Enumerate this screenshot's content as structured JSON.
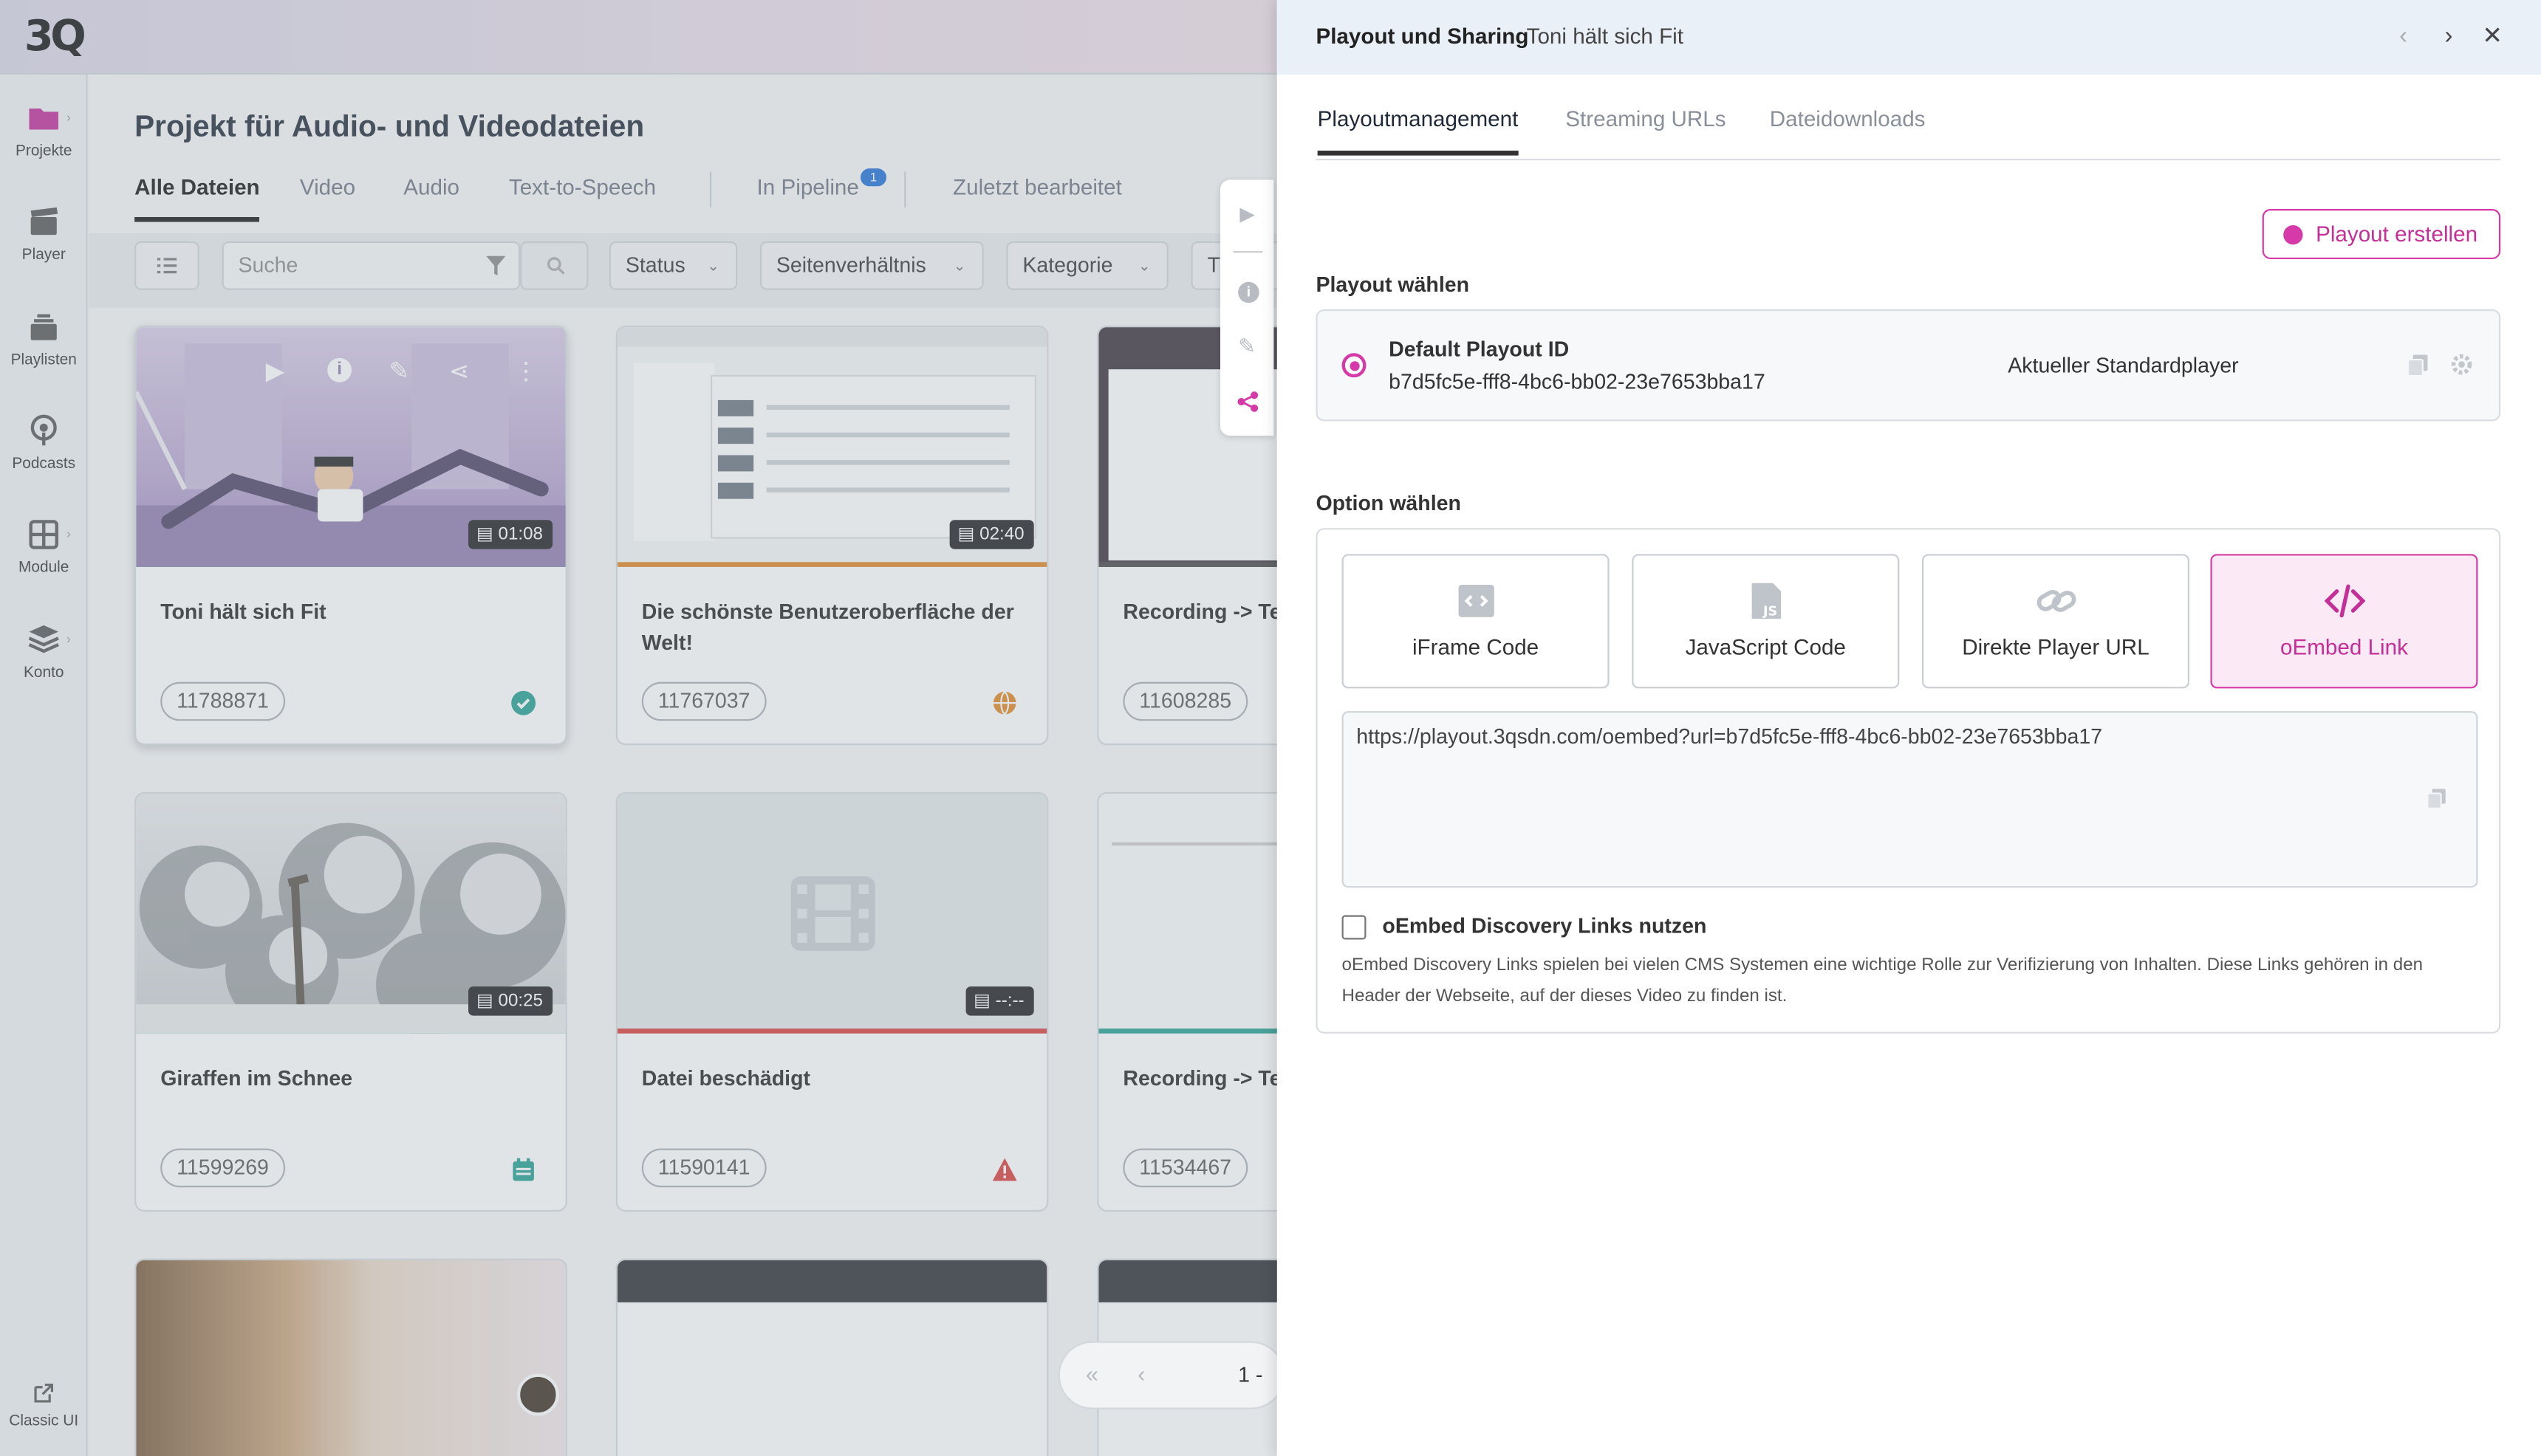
{
  "app": {
    "logo": "3Q",
    "classic_ui": "Classic UI"
  },
  "sidebar": {
    "items": [
      {
        "label": "Projekte",
        "icon": "folder-icon"
      },
      {
        "label": "Player",
        "icon": "clapperboard-icon"
      },
      {
        "label": "Playlisten",
        "icon": "playlist-icon"
      },
      {
        "label": "Podcasts",
        "icon": "podcast-icon"
      },
      {
        "label": "Module",
        "icon": "grid-icon"
      },
      {
        "label": "Konto",
        "icon": "layers-icon"
      }
    ]
  },
  "main": {
    "title": "Projekt für Audio- und Videodateien",
    "tabs": [
      "Alle Dateien",
      "Video",
      "Audio",
      "Text-to-Speech",
      "In Pipeline",
      "Zuletzt bearbeitet"
    ],
    "pipeline_badge": "1",
    "search_placeholder": "Suche",
    "filters": [
      "Status",
      "Seitenverhältnis",
      "Kategorie",
      "T"
    ],
    "cards": [
      {
        "title": "Toni hält sich Fit",
        "id": "11788871",
        "duration": "01:08",
        "status": "published-check-icon"
      },
      {
        "title": "Die schönste Benutzeroberfläche der Welt!",
        "id": "11767037",
        "duration": "02:40",
        "status": "globe-icon"
      },
      {
        "title": "Recording -> Te Live Übertragur",
        "id": "11608285",
        "duration": "",
        "status": ""
      },
      {
        "title": "Giraffen im Schnee",
        "id": "11599269",
        "duration": "00:25",
        "status": "calendar-icon"
      },
      {
        "title": "Datei beschädigt",
        "id": "11590141",
        "duration": "--:--",
        "status": "warning-icon"
      },
      {
        "title": "Recording -> Te Live Übertragur",
        "id": "11534467",
        "duration": "",
        "status": ""
      }
    ],
    "pager": {
      "page": "1 -"
    }
  },
  "panel": {
    "title": "Playout und Sharing",
    "subtitle": "Toni hält sich Fit",
    "tabs": [
      "Playoutmanagement",
      "Streaming URLs",
      "Dateidownloads"
    ],
    "create_button": "Playout erstellen",
    "choose_playout_label": "Playout wählen",
    "playout": {
      "name": "Default Playout ID",
      "id": "b7d5fc5e-fff8-4bc6-bb02-23e7653bba17",
      "status": "Aktueller Standardplayer"
    },
    "choose_option_label": "Option wählen",
    "options": [
      {
        "label": "iFrame Code",
        "icon": "code-window-icon"
      },
      {
        "label": "JavaScript Code",
        "icon": "js-file-icon"
      },
      {
        "label": "Direkte Player URL",
        "icon": "link-icon"
      },
      {
        "label": "oEmbed Link",
        "icon": "code-brackets-icon"
      }
    ],
    "selected_option": "oEmbed Link",
    "url": "https://playout.3qsdn.com/oembed?url=b7d5fc5e-fff8-4bc6-bb02-23e7653bba17",
    "discovery_label": "oEmbed Discovery Links nutzen",
    "discovery_help": "oEmbed Discovery Links spielen bei vielen CMS Systemen eine wichtige Rolle zur Verifizierung von Inhalten. Diese Links gehören in den Header der Webseite, auf der dieses Video zu finden ist."
  },
  "colors": {
    "accent": "#d63aa8",
    "teal": "#1f9d8f",
    "danger": "#d93a3a",
    "orange": "#e0841e"
  }
}
